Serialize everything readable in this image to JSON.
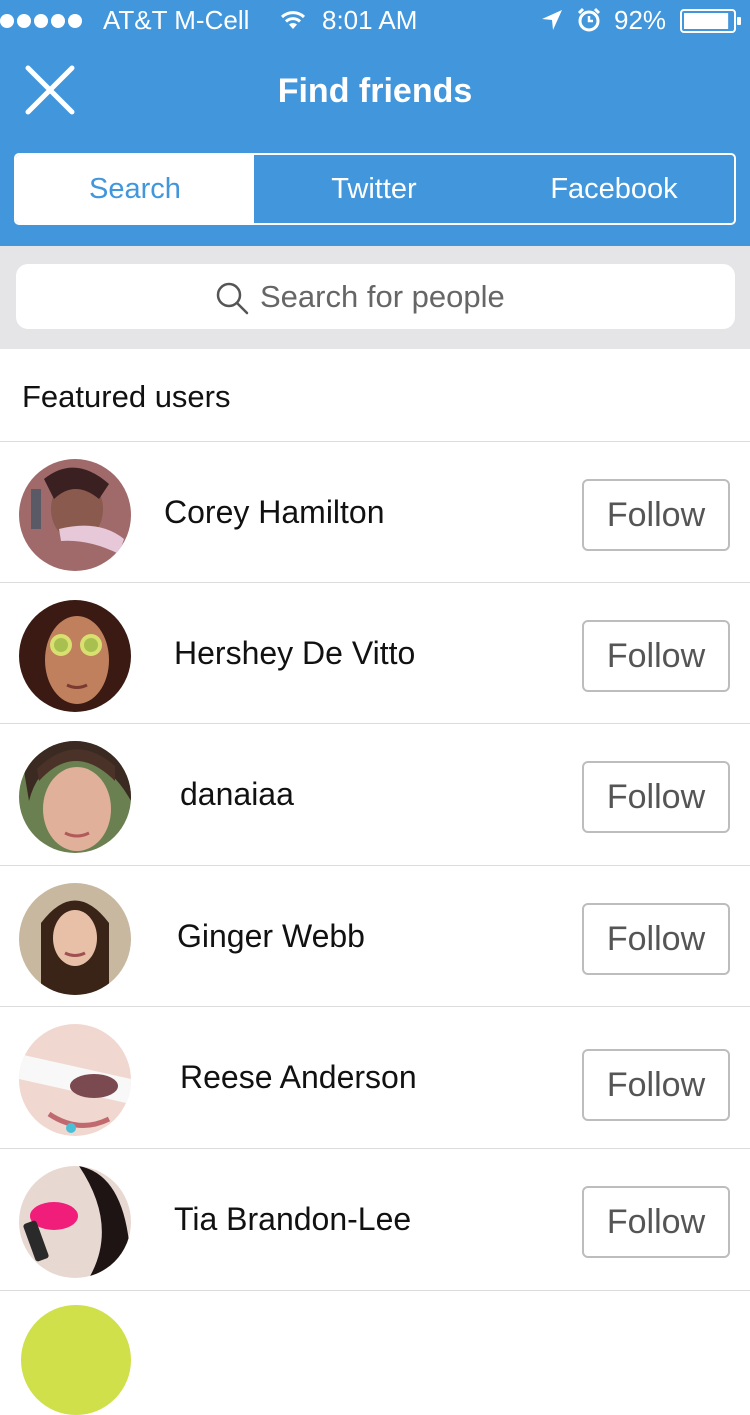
{
  "status_bar": {
    "carrier": "AT&T M-Cell",
    "time": "8:01 AM",
    "battery": "92%",
    "battery_level": 0.92
  },
  "header": {
    "title": "Find friends",
    "close_icon": "close-icon"
  },
  "tabs": [
    {
      "label": "Search",
      "active": true
    },
    {
      "label": "Twitter",
      "active": false
    },
    {
      "label": "Facebook",
      "active": false
    }
  ],
  "search": {
    "placeholder": "Search for people",
    "value": ""
  },
  "section": {
    "title": "Featured users"
  },
  "users": [
    {
      "name": "Corey Hamilton",
      "button": "Follow"
    },
    {
      "name": "Hershey De Vitto",
      "button": "Follow"
    },
    {
      "name": "danaiaa",
      "button": "Follow"
    },
    {
      "name": "Ginger Webb",
      "button": "Follow"
    },
    {
      "name": "Reese Anderson",
      "button": "Follow"
    },
    {
      "name": "Tia Brandon-Lee",
      "button": "Follow"
    }
  ],
  "colors": {
    "header_bg": "#4196dc",
    "search_bg": "#e5e5e7",
    "accent": "#4196dc"
  }
}
